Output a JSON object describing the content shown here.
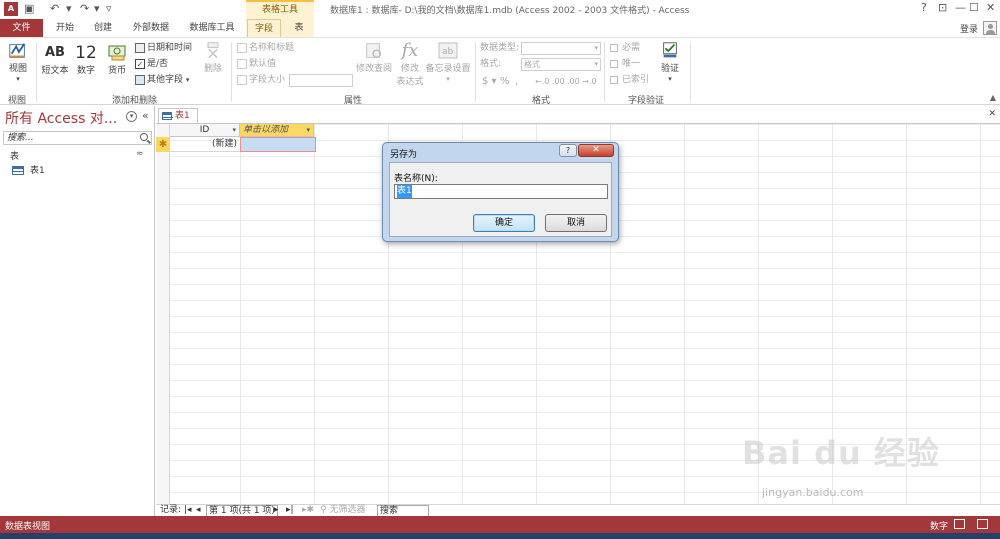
{
  "title_bar": {
    "app_logo": "A",
    "context_tool": "表格工具",
    "window_title": "数据库1 : 数据库- D:\\我的文档\\数据库1.mdb (Access 2002 - 2003 文件格式) - Access",
    "help": "?",
    "restore": "⊡",
    "minimize": "—",
    "maximize": "☐",
    "close": "✕"
  },
  "tabs": {
    "file": "文件",
    "home": "开始",
    "create": "创建",
    "external": "外部数据",
    "db_tools": "数据库工具",
    "fields": "字段",
    "table": "表",
    "login": "登录"
  },
  "ribbon": {
    "view": "视图",
    "short_text": "短文本",
    "short_text_icon": "AB",
    "number": "数字",
    "number_icon": "12",
    "currency": "货币",
    "date_time": "日期和时间",
    "yes_no": "是/否",
    "more_fields": "其他字段",
    "delete": "删除",
    "name_caption": "名称和标题",
    "default_value": "默认值",
    "field_size": "字段大小",
    "modify_lookups": "修改查阅",
    "modify_expression_1": "修改",
    "modify_expression_2": "表达式",
    "memo_settings": "备忘录设置",
    "data_type": "数据类型:",
    "format": "格式:",
    "format_value": "格式",
    "required": "必需",
    "unique": "唯一",
    "indexed": "已索引",
    "validation": "验证",
    "groups": {
      "views": "视图",
      "add_delete": "添加和删除",
      "properties": "属性",
      "formatting": "格式",
      "field_validation": "字段验证"
    }
  },
  "nav_pane": {
    "title": "所有 Access 对...",
    "search_placeholder": "搜索...",
    "group": "表",
    "items": [
      {
        "label": "表1"
      }
    ]
  },
  "document": {
    "tab": "表1",
    "columns": {
      "id": "ID",
      "add": "单击以添加"
    },
    "new_row_marker": "✱",
    "new_record": "(新建)"
  },
  "record_nav": {
    "label": "记录:",
    "position": "第 1 项(共 1 项)",
    "filter": "无筛选器",
    "search": "搜索"
  },
  "dialog": {
    "title": "另存为",
    "help": "?",
    "close": "✕",
    "label": "表名称(N):",
    "value": "表1",
    "ok": "确定",
    "cancel": "取消"
  },
  "status_bar": {
    "left": "数据表视图",
    "right": "数字"
  },
  "watermark": {
    "logo": "Bai du 经验",
    "url": "jingyan.baidu.com"
  },
  "colors": {
    "access_red": "#a4373a",
    "context_yellow": "#fbd766",
    "selection_blue": "#c5dcf3"
  }
}
